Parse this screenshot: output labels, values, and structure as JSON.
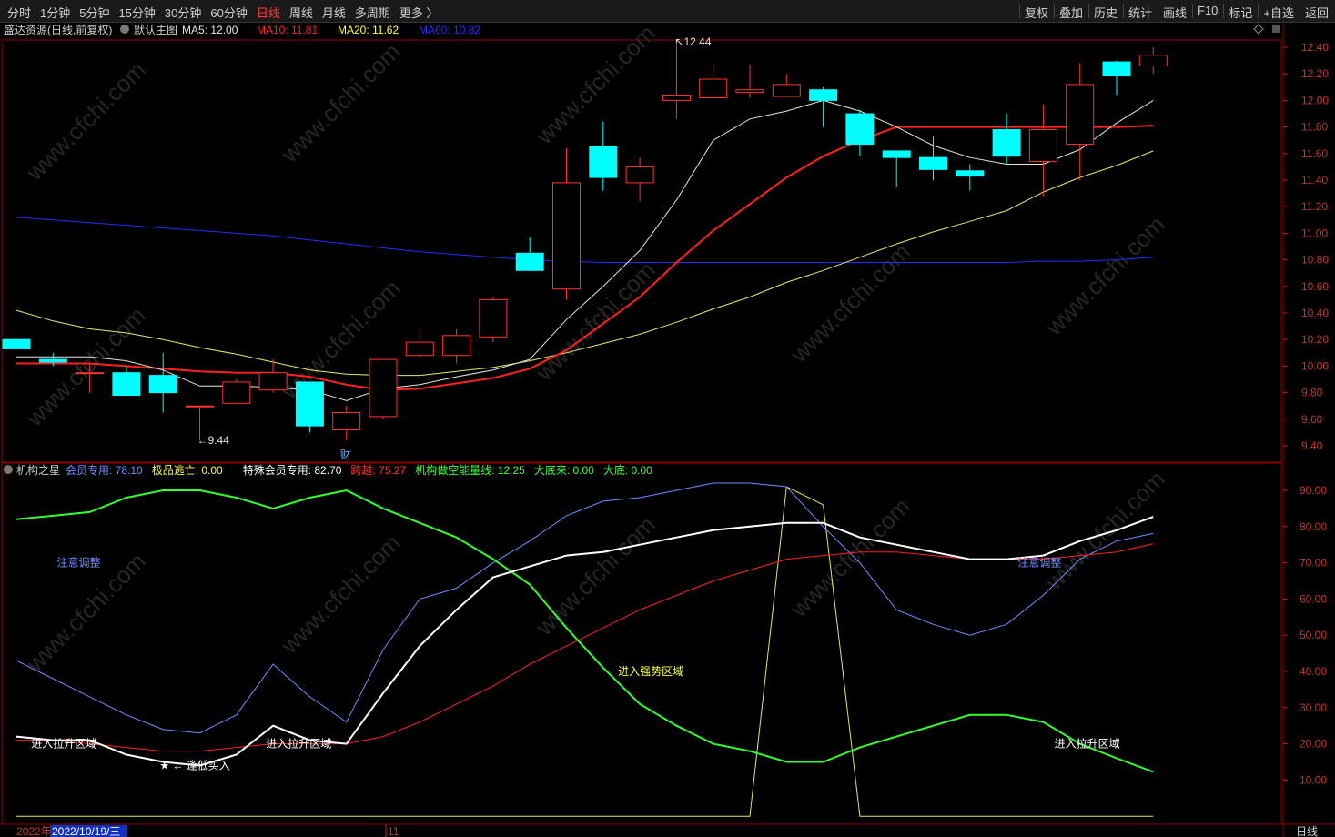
{
  "toolbar": {
    "periods": [
      "分时",
      "1分钟",
      "5分钟",
      "15分钟",
      "30分钟",
      "60分钟",
      "日线",
      "周线",
      "月线",
      "多周期",
      "更多 〉"
    ],
    "active": "日线",
    "right": [
      "复权",
      "叠加",
      "历史",
      "统计",
      "画线",
      "F10",
      "标记",
      "+自选",
      "返回"
    ]
  },
  "main": {
    "stock": "盛达资源(日线,前复权)",
    "template": "默认主图",
    "ma": [
      {
        "label": "MA5: 12.00",
        "color": "#e6e6e6"
      },
      {
        "label": "MA10: 11.81",
        "color": "#ff2020"
      },
      {
        "label": "MA20: 11.62",
        "color": "#ffff40"
      },
      {
        "label": "MA60: 10.82",
        "color": "#2a2aff"
      }
    ],
    "y_ticks": [
      "12.40",
      "12.20",
      "12.00",
      "11.80",
      "11.60",
      "11.40",
      "11.20",
      "11.00",
      "10.80",
      "10.60",
      "10.40",
      "10.20",
      "10.00",
      "9.80",
      "9.60",
      "9.40"
    ],
    "high_label": "12.44",
    "low_label": "9.44",
    "fin_label": "财",
    "candles": [
      {
        "o": 10.2,
        "h": 10.2,
        "l": 10.15,
        "c": 10.13
      },
      {
        "o": 10.05,
        "h": 10.1,
        "l": 10.0,
        "c": 10.03
      },
      {
        "o": 9.95,
        "h": 10.02,
        "l": 9.8,
        "c": 9.95
      },
      {
        "o": 9.95,
        "h": 10.0,
        "l": 9.78,
        "c": 9.78
      },
      {
        "o": 9.93,
        "h": 10.1,
        "l": 9.65,
        "c": 9.8
      },
      {
        "o": 9.7,
        "h": 9.7,
        "l": 9.44,
        "c": 9.7
      },
      {
        "o": 9.72,
        "h": 9.9,
        "l": 9.72,
        "c": 9.88
      },
      {
        "o": 9.82,
        "h": 10.05,
        "l": 9.8,
        "c": 9.95
      },
      {
        "o": 9.88,
        "h": 9.88,
        "l": 9.5,
        "c": 9.55
      },
      {
        "o": 9.52,
        "h": 9.7,
        "l": 9.44,
        "c": 9.65
      },
      {
        "o": 9.62,
        "h": 10.05,
        "l": 9.6,
        "c": 10.05
      },
      {
        "o": 10.08,
        "h": 10.28,
        "l": 10.05,
        "c": 10.18
      },
      {
        "o": 10.08,
        "h": 10.28,
        "l": 10.02,
        "c": 10.23
      },
      {
        "o": 10.22,
        "h": 10.52,
        "l": 10.18,
        "c": 10.5
      },
      {
        "o": 10.85,
        "h": 10.97,
        "l": 10.72,
        "c": 10.72
      },
      {
        "o": 10.58,
        "h": 11.64,
        "l": 10.5,
        "c": 11.38
      },
      {
        "o": 11.65,
        "h": 11.84,
        "l": 11.32,
        "c": 11.42
      },
      {
        "o": 11.38,
        "h": 11.57,
        "l": 11.24,
        "c": 11.5
      },
      {
        "o": 12.0,
        "h": 12.44,
        "l": 11.86,
        "c": 12.04
      },
      {
        "o": 12.02,
        "h": 12.28,
        "l": 12.02,
        "c": 12.16
      },
      {
        "o": 12.06,
        "h": 12.27,
        "l": 12.02,
        "c": 12.08
      },
      {
        "o": 12.03,
        "h": 12.2,
        "l": 12.03,
        "c": 12.12
      },
      {
        "o": 12.08,
        "h": 12.1,
        "l": 11.8,
        "c": 12.0
      },
      {
        "o": 11.9,
        "h": 11.93,
        "l": 11.58,
        "c": 11.67
      },
      {
        "o": 11.62,
        "h": 11.62,
        "l": 11.35,
        "c": 11.57
      },
      {
        "o": 11.57,
        "h": 11.73,
        "l": 11.4,
        "c": 11.48
      },
      {
        "o": 11.47,
        "h": 11.52,
        "l": 11.32,
        "c": 11.43
      },
      {
        "o": 11.78,
        "h": 11.9,
        "l": 11.52,
        "c": 11.58
      },
      {
        "o": 11.54,
        "h": 11.97,
        "l": 11.28,
        "c": 11.78
      },
      {
        "o": 11.67,
        "h": 12.28,
        "l": 11.4,
        "c": 12.12
      },
      {
        "o": 12.29,
        "h": 12.3,
        "l": 12.04,
        "c": 12.19
      },
      {
        "o": 12.26,
        "h": 12.4,
        "l": 12.2,
        "c": 12.34
      }
    ],
    "ma5": [
      10.07,
      10.07,
      10.07,
      10.04,
      9.97,
      9.85,
      9.85,
      9.84,
      9.82,
      9.74,
      9.83,
      9.86,
      9.92,
      9.97,
      10.05,
      10.35,
      10.6,
      10.87,
      11.25,
      11.7,
      11.86,
      11.92,
      12.0,
      11.92,
      11.8,
      11.66,
      11.57,
      11.52,
      11.52,
      11.63,
      11.83,
      12.0
    ],
    "ma10": [
      10.02,
      10.02,
      10.02,
      10.0,
      9.98,
      9.96,
      9.95,
      9.95,
      9.92,
      9.86,
      9.82,
      9.83,
      9.87,
      9.91,
      9.98,
      10.12,
      10.32,
      10.52,
      10.78,
      11.02,
      11.22,
      11.42,
      11.58,
      11.7,
      11.8,
      11.8,
      11.8,
      11.8,
      11.8,
      11.8,
      11.8,
      11.81
    ],
    "ma20": [
      10.42,
      10.34,
      10.28,
      10.25,
      10.2,
      10.14,
      10.09,
      10.03,
      9.97,
      9.94,
      9.93,
      9.93,
      9.96,
      9.99,
      10.04,
      10.1,
      10.17,
      10.24,
      10.33,
      10.43,
      10.52,
      10.63,
      10.72,
      10.82,
      10.92,
      11.01,
      11.09,
      11.17,
      11.31,
      11.42,
      11.51,
      11.62
    ],
    "ma60": [
      11.12,
      11.1,
      11.08,
      11.06,
      11.04,
      11.02,
      11.0,
      10.98,
      10.95,
      10.92,
      10.89,
      10.86,
      10.84,
      10.82,
      10.8,
      10.79,
      10.78,
      10.78,
      10.78,
      10.78,
      10.78,
      10.78,
      10.78,
      10.78,
      10.78,
      10.78,
      10.78,
      10.78,
      10.79,
      10.79,
      10.8,
      10.82
    ],
    "colors": {
      "up": "#ff3232",
      "down": "#00ffff",
      "bg": "#000000",
      "axis": "#8b0000"
    }
  },
  "sub": {
    "name": "机构之星",
    "indicators": [
      {
        "label": "会员专用: 78.10",
        "color": "#6f8fff"
      },
      {
        "label": "极品逃亡: 0.00",
        "color": "#ffff40"
      },
      {
        "label": "特殊会员专用: 82.70",
        "color": "#ffffff"
      },
      {
        "label": "跨越: 75.27",
        "color": "#ff3232"
      },
      {
        "label": "机构做空能量线: 12.25",
        "color": "#40ff40"
      },
      {
        "label": "大底来: 0.00",
        "color": "#40ff40"
      },
      {
        "label": "大底: 0.00",
        "color": "#40ff40"
      }
    ],
    "y_ticks": [
      "90.00",
      "80.00",
      "70.00",
      "60.00",
      "50.00",
      "40.00",
      "30.00",
      "20.00",
      "10.00"
    ],
    "annotations": [
      {
        "text": "注意调整",
        "color": "#6f8fff",
        "idx": 1.6,
        "v": 70
      },
      {
        "text": "进入拉升区域",
        "color": "#ffffff",
        "idx": 0.9,
        "v": 20
      },
      {
        "text": "进入拉升区域",
        "color": "#ffffff",
        "idx": 7.3,
        "v": 20
      },
      {
        "text": "★ ← 逢低买入",
        "color": "#ffffff",
        "idx": 4.4,
        "v": 14
      },
      {
        "text": "进入强势区域",
        "color": "#ffff40",
        "idx": 16.9,
        "v": 40
      },
      {
        "text": "注意调整",
        "color": "#6f8fff",
        "idx": 27.8,
        "v": 70
      },
      {
        "text": "进入拉升区域",
        "color": "#ffffff",
        "idx": 28.8,
        "v": 20
      }
    ],
    "blue": [
      43,
      38,
      33,
      28,
      24,
      23,
      28,
      42,
      33,
      26,
      46,
      60,
      63,
      70,
      76,
      83,
      87,
      88,
      90,
      92,
      92,
      91,
      80,
      70,
      57,
      53,
      50,
      53,
      61,
      71,
      76,
      78.1
    ],
    "white": [
      22,
      21,
      21,
      17,
      15,
      14,
      17,
      25,
      21,
      20,
      34,
      47,
      57,
      66,
      69,
      72,
      73,
      75,
      77,
      79,
      80,
      81,
      81,
      77,
      75,
      73,
      71,
      71,
      72,
      76,
      79,
      82.7
    ],
    "red": [
      21,
      21,
      20,
      19,
      18,
      18,
      19,
      20,
      20,
      20,
      22,
      26,
      31,
      36,
      42,
      47,
      52,
      57,
      61,
      65,
      68,
      71,
      72,
      73,
      73,
      72,
      71,
      71,
      71,
      72,
      73,
      75.27
    ],
    "green": [
      82,
      83,
      84,
      88,
      90,
      90,
      88,
      85,
      88,
      90,
      85,
      81,
      77,
      71,
      64,
      52,
      41,
      31,
      25,
      20,
      18,
      15,
      15,
      19,
      22,
      25,
      28,
      28,
      26,
      20,
      16,
      12.25
    ],
    "yellow": [
      0,
      0,
      0,
      0,
      0,
      0,
      0,
      0,
      0,
      0,
      0,
      0,
      0,
      0,
      0,
      0,
      0,
      0,
      0,
      0,
      0,
      91,
      86,
      0,
      0,
      0,
      0,
      0,
      0,
      0,
      0,
      0
    ]
  },
  "xaxis": {
    "year": "2022年",
    "date": "2022/10/19/三",
    "month": "11",
    "period": "日线"
  },
  "watermark": "www.cfchi.com"
}
